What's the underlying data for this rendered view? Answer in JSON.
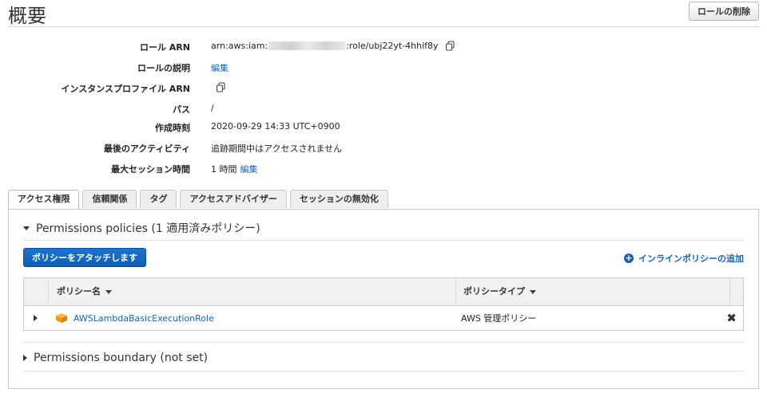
{
  "header": {
    "title": "概要",
    "delete_role_label": "ロールの削除"
  },
  "summary": {
    "role_arn_label": "ロール ARN",
    "role_arn_prefix": "arn:aws:iam:",
    "role_arn_suffix": ":role/ubj22yt-4hhif8y",
    "role_description_label": "ロールの説明",
    "role_description_edit": "編集",
    "instance_profile_label": "インスタンスプロファイル ARN",
    "path_label": "パス",
    "path_value": "/",
    "created_label": "作成時刻",
    "created_value": "2020-09-29 14:33 UTC+0900",
    "last_activity_label": "最後のアクティビティ",
    "last_activity_value": "追跡期間中はアクセスされません",
    "max_session_label": "最大セッション時間",
    "max_session_value": "1 時間",
    "max_session_edit": "編集"
  },
  "tabs": [
    {
      "label": "アクセス権限",
      "active": true
    },
    {
      "label": "信頼関係",
      "active": false
    },
    {
      "label": "タグ",
      "active": false
    },
    {
      "label": "アクセスアドバイザー",
      "active": false
    },
    {
      "label": "セッションの無効化",
      "active": false
    }
  ],
  "permissions": {
    "section_title": "Permissions policies (1 適用済みポリシー)",
    "attach_button": "ポリシーをアタッチします",
    "add_inline": "インラインポリシーの追加",
    "columns": {
      "name": "ポリシー名",
      "type": "ポリシータイプ"
    },
    "rows": [
      {
        "name": "AWSLambdaBasicExecutionRole",
        "type": "AWS 管理ポリシー"
      }
    ]
  },
  "boundary": {
    "section_title": "Permissions boundary (not set)"
  },
  "icons": {
    "copy": "copy-icon",
    "plus": "plus-circle-icon",
    "policy": "package-icon",
    "remove": "close-icon"
  },
  "colors": {
    "link": "#1166bb",
    "primary_button": "#1a73d0",
    "policy_icon": "#f39c12"
  }
}
